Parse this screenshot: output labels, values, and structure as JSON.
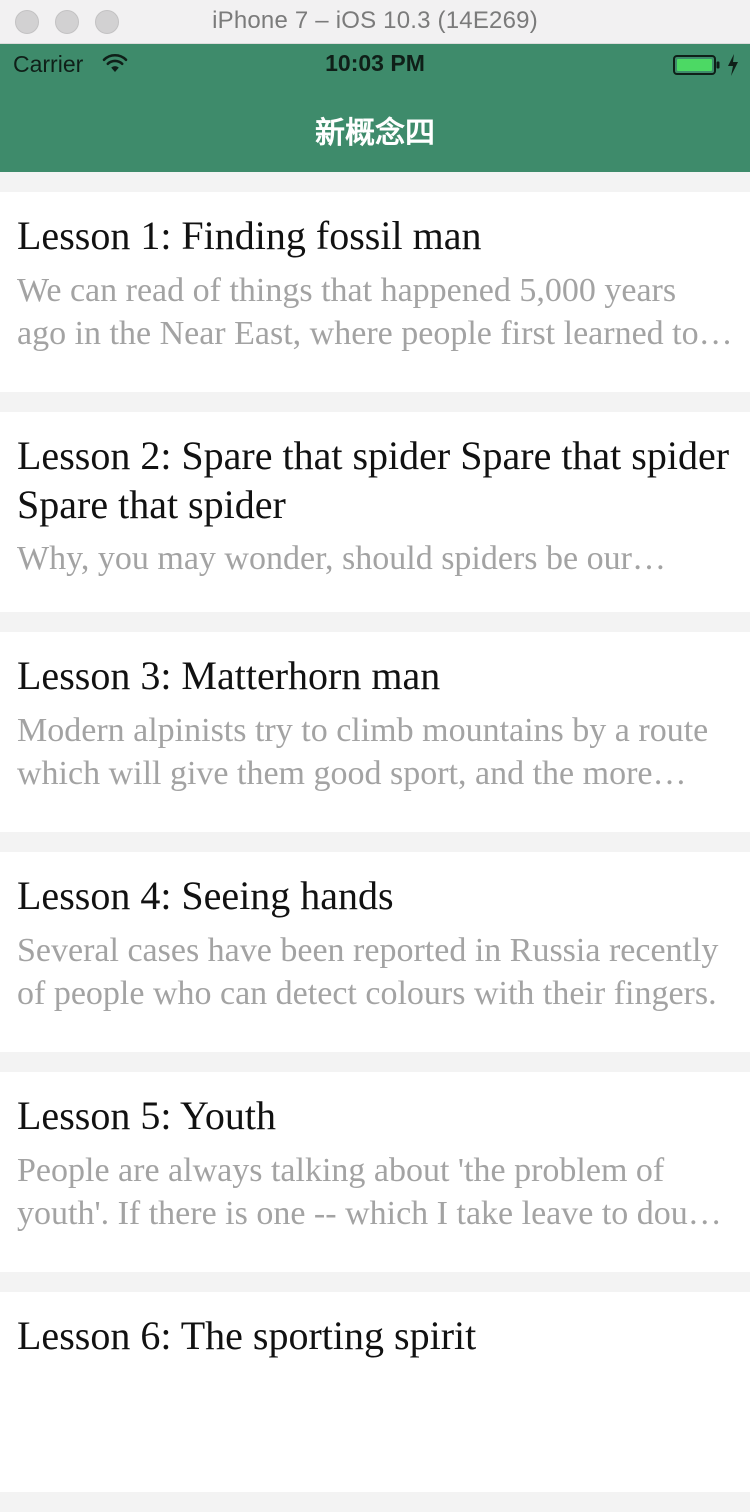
{
  "window": {
    "title": "iPhone 7 – iOS 10.3 (14E269)"
  },
  "status_bar": {
    "carrier": "Carrier",
    "time": "10:03 PM",
    "battery_color": "#4cd964"
  },
  "nav": {
    "title": "新概念四",
    "bar_color": "#3e8b6b"
  },
  "lessons": [
    {
      "title": "Lesson 1: Finding fossil man",
      "desc": "We can read of things that happened 5,000 years ago in the Near East, where people first learned to write."
    },
    {
      "title": "Lesson 2: Spare that spider Spare that spider Spare that spider",
      "desc": "Why, you may wonder, should spiders be our friends?"
    },
    {
      "title": "Lesson 3: Matterhorn man",
      "desc": "Modern alpinists try to climb mountains by a route which will give them good sport, and the more difficult it is, the more highly it is regarded."
    },
    {
      "title": "Lesson 4: Seeing hands",
      "desc": "Several cases have been reported in Russia recently of people who can detect colours with their fingers."
    },
    {
      "title": "Lesson 5: Youth",
      "desc": "People are always talking about 'the problem of youth'. If there is one -- which I take leave to doubt -- then it is older people who create it."
    },
    {
      "title": "Lesson 6: The sporting spirit",
      "desc": ""
    }
  ]
}
